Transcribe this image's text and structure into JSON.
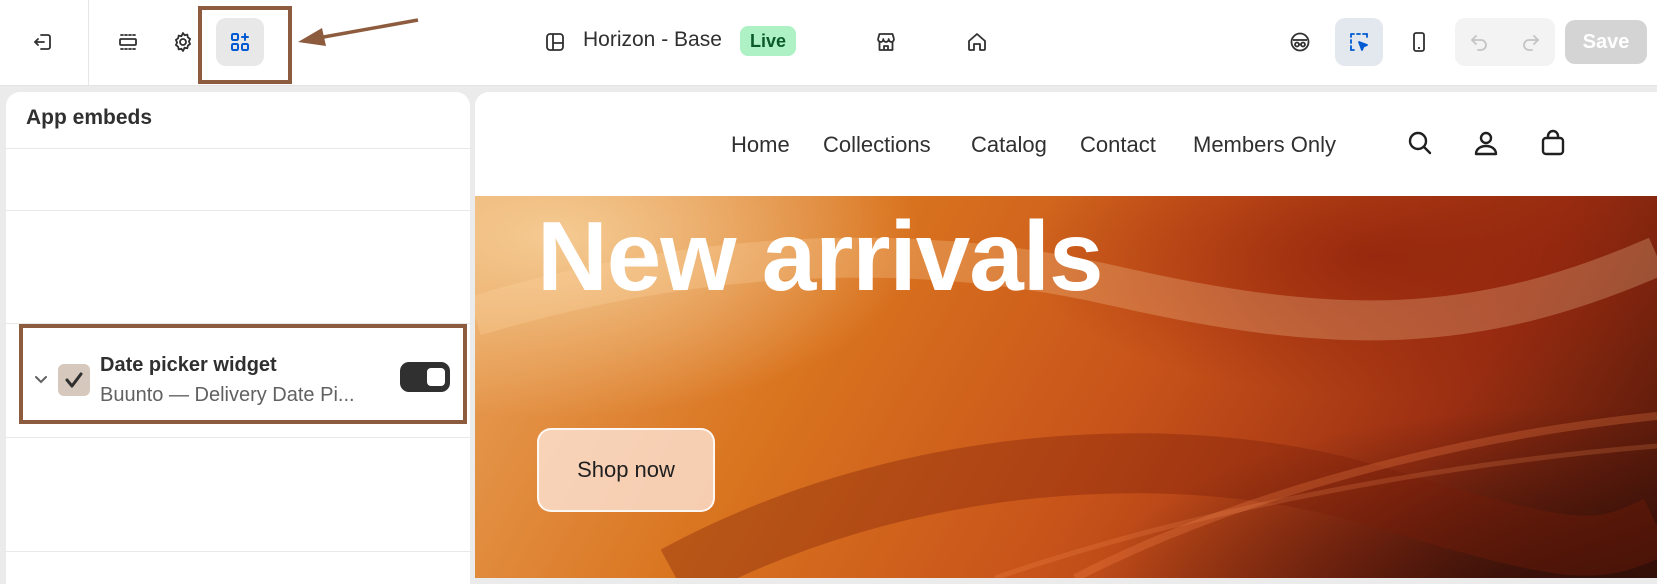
{
  "topbar": {
    "theme_name": "Horizon - Base",
    "status_badge": "Live",
    "save_label": "Save",
    "icons": [
      "exit-icon",
      "sections-icon",
      "settings-icon",
      "app-embeds-icon",
      "layout-icon",
      "store-icon",
      "home-icon",
      "incognito-icon",
      "inspector-icon",
      "mobile-icon",
      "undo-icon",
      "redo-icon"
    ],
    "colors": {
      "live_bg": "#aef1c5",
      "accent": "#005bd3",
      "annotation": "#8d5b3d"
    }
  },
  "panel": {
    "title": "App embeds",
    "embed": {
      "title": "Date picker widget",
      "subtitle": "Buunto — Delivery Date Pi...",
      "enabled": true
    }
  },
  "preview": {
    "nav": {
      "links": [
        "Home",
        "Collections",
        "Catalog",
        "Contact",
        "Members Only"
      ],
      "icons": [
        "search-icon",
        "account-icon",
        "cart-icon"
      ]
    },
    "hero": {
      "title": "New arrivals",
      "button_label": "Shop now"
    }
  }
}
